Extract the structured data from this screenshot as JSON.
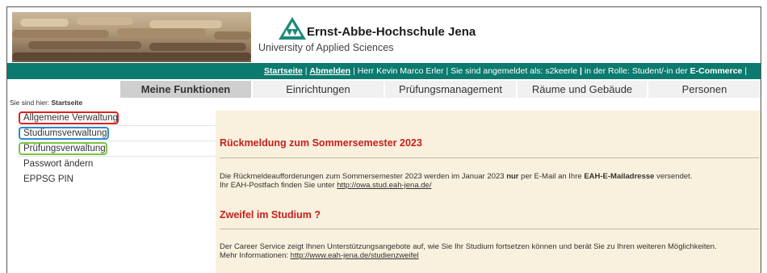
{
  "header": {
    "logo_title": "Ernst-Abbe-Hochschule Jena",
    "logo_subtitle": "University of Applied Sciences"
  },
  "topbar": {
    "home_link": "Startseite",
    "sep1": " | ",
    "logout_link": "Abmelden",
    "user_text": " | Herr Kevin Marco Erler | Sie sind angemeldet als: s2keerle ",
    "sep2": " | ",
    "role_text": " in der Rolle: Student/-in der ",
    "role_bold": "E-Commerce",
    "sep3": " |"
  },
  "tabs": [
    {
      "label": "Meine Funktionen",
      "active": true
    },
    {
      "label": "Einrichtungen",
      "active": false
    },
    {
      "label": "Prüfungsmanagement",
      "active": false
    },
    {
      "label": "Räume und Gebäude",
      "active": false
    },
    {
      "label": "Personen",
      "active": false
    }
  ],
  "breadcrumb": {
    "prefix": "Sie sind hier: ",
    "current": "Startseite"
  },
  "sidebar": {
    "items": [
      {
        "label": "Allgemeine Verwaltung",
        "highlight": "#e02020"
      },
      {
        "label": "Studiumsverwaltung",
        "highlight": "#2a8ad0"
      },
      {
        "label": "Prüfungsverwaltung",
        "highlight": "#7cc242"
      },
      {
        "label": "Passwort ändern",
        "highlight": ""
      },
      {
        "label": "EPPSG PIN",
        "highlight": ""
      }
    ]
  },
  "content": {
    "section1": {
      "title": "Rückmeldung zum Sommersemester 2023",
      "line1_a": "Die Rückmeldeaufforderungen zum Sommersemester 2023 werden im Januar 2023 ",
      "line1_b": "nur",
      "line1_c": " per E-Mail an Ihre ",
      "line1_d": "EAH-E-Mailadresse",
      "line1_e": " versendet.",
      "line2_a": "Ihr EAH-Postfach finden Sie unter ",
      "line2_link": "http://owa.stud.eah-jena.de/"
    },
    "section2": {
      "title": "Zweifel im Studium ?",
      "line1": "Der Career Service zeigt Ihnen Unterstützungsangebote auf, wie Sie Ihr Studium fortsetzen können und berät Sie zu Ihren weiteren Möglichkeiten.",
      "line2_a": "Mehr Informationen: ",
      "line2_link": "http://www.eah-jena.de/studienzweifel"
    }
  },
  "colors": {
    "accent": "#0c7a6e",
    "heading": "#c8201c",
    "content_bg": "#faf0de"
  }
}
